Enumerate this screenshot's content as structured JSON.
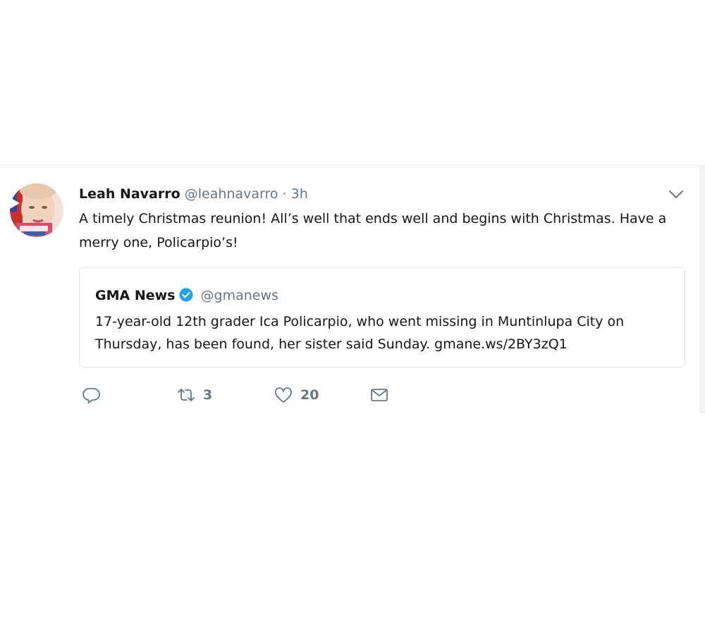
{
  "tweet": {
    "author_name": "Leah Navarro",
    "author_handle": "@leahnavarro",
    "separator": "·",
    "time": "3h",
    "text": "A timely Christmas reunion! All’s well that ends well and begins with Christmas. Have a merry one, Policarpio’s!",
    "avatar_icon": "profile-photo"
  },
  "quoted": {
    "author_name": "GMA News",
    "author_handle": "@gmanews",
    "verified": true,
    "text": "17-year-old 12th grader Ica Policarpio, who went missing in Muntinlupa City on Thursday, has been found, her sister said Sunday. gmane.ws/2BY3zQ1"
  },
  "actions": {
    "reply_icon": "reply-icon",
    "retweet_icon": "retweet-icon",
    "retweet_count": "3",
    "like_icon": "heart-icon",
    "like_count": "20",
    "dm_icon": "envelope-icon"
  },
  "colors": {
    "text": "#14171a",
    "secondary": "#657786",
    "verified": "#1da1f2",
    "border": "#e1e8ed"
  }
}
